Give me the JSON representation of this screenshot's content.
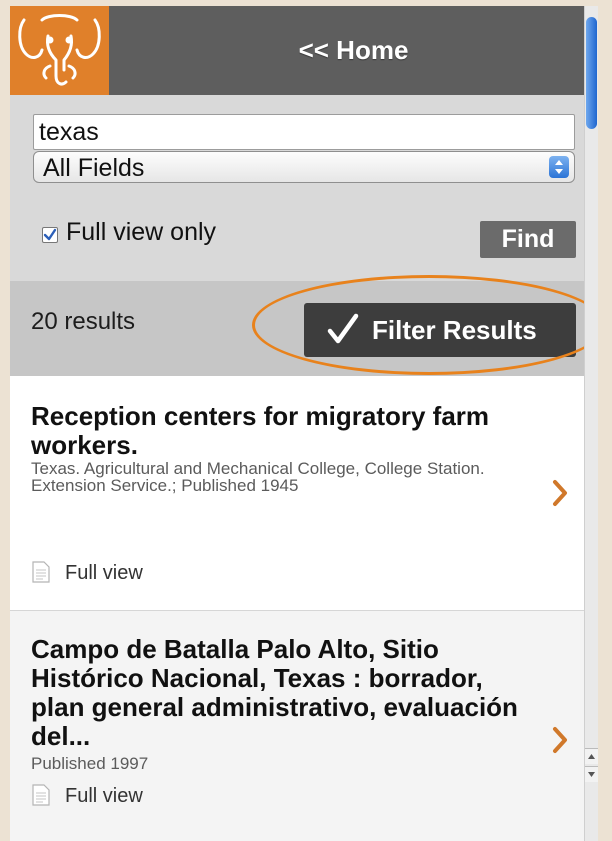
{
  "header": {
    "home_label": "<< Home"
  },
  "search": {
    "query": "texas",
    "field": "All Fields",
    "full_view_only_label": "Full view only",
    "full_view_only_checked": true,
    "find_label": "Find"
  },
  "results": {
    "count_label": "20 results",
    "filter_label": "Filter Results",
    "items": [
      {
        "title": "Reception centers for migratory farm workers.",
        "meta": "Texas. Agricultural and Mechanical College, College Station. Extension Service.; Published 1945",
        "access": "Full view"
      },
      {
        "title": "Campo de Batalla Palo Alto, Sitio Histórico Nacional, Texas : borrador, plan general administrativo, evaluación del...",
        "meta": "Published 1997",
        "access": "Full view"
      }
    ]
  },
  "colors": {
    "brand_orange": "#e0802a",
    "header_gray": "#5e5e5e",
    "highlight_oval": "#e8821c"
  }
}
